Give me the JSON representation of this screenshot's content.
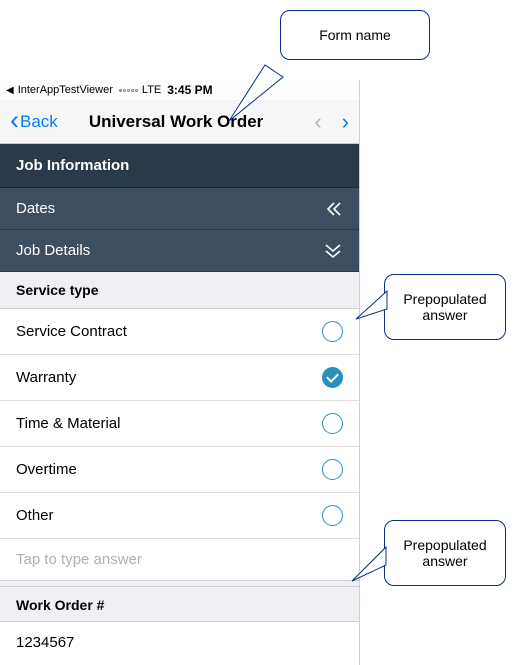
{
  "status": {
    "back_app": "InterAppTestViewer",
    "network": "LTE",
    "time": "3:45 PM"
  },
  "nav": {
    "back_label": "Back",
    "title": "Universal Work Order"
  },
  "sections": {
    "job_info": "Job Information",
    "dates": "Dates",
    "job_details": "Job Details"
  },
  "service_type": {
    "header": "Service type",
    "options": [
      {
        "label": "Service Contract",
        "checked": false
      },
      {
        "label": "Warranty",
        "checked": true
      },
      {
        "label": "Time & Material",
        "checked": false
      },
      {
        "label": "Overtime",
        "checked": false
      },
      {
        "label": "Other",
        "checked": false
      }
    ],
    "placeholder": "Tap to type answer"
  },
  "work_order": {
    "label": "Work Order #",
    "value": "1234567"
  },
  "callouts": {
    "form_name": "Form name",
    "prepop1": "Prepopulated answer",
    "prepop2": "Prepopulated answer"
  }
}
